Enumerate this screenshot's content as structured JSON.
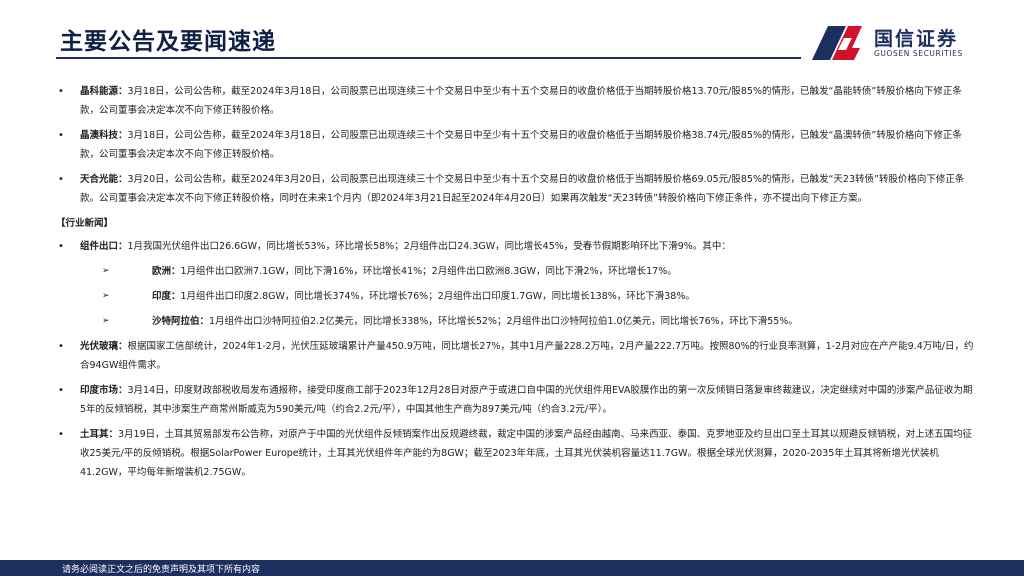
{
  "header": {
    "title": "主要公告及要闻速递",
    "logo_cn": "国信证券",
    "logo_en": "GUOSEN SECURITIES",
    "logo_icon": "guosen-logo-icon",
    "accent_red": "#d0122b",
    "brand_navy": "#1d2f5f"
  },
  "announcements": [
    {
      "name": "晶科能源：",
      "text": "3月18日，公司公告称，截至2024年3月18日，公司股票已出现连续三十个交易日中至少有十五个交易日的收盘价格低于当期转股价格13.70元/股85%的情形，已触发“晶能转债”转股价格向下修正条款，公司董事会决定本次不向下修正转股价格。"
    },
    {
      "name": "晶澳科技：",
      "text": "3月18日，公司公告称，截至2024年3月18日，公司股票已出现连续三十个交易日中至少有十五个交易日的收盘价格低于当期转股价格38.74元/股85%的情形，已触发“晶澳转债”转股价格向下修正条款，公司董事会决定本次不向下修正转股价格。"
    },
    {
      "name": "天合光能：",
      "text": "3月20日，公司公告称，截至2024年3月20日，公司股票已出现连续三十个交易日中至少有十五个交易日的收盘价格低于当期转股价格69.05元/股85%的情形，已触发“天23转债”转股价格向下修正条款。公司董事会决定本次不向下修正转股价格，同时在未来1个月内（即2024年3月21日起至2024年4月20日）如果再次触发“天23转债”转股价格向下修正条件，亦不提出向下修正方案。"
    }
  ],
  "industry": {
    "heading": "【行业新闻】",
    "export": {
      "name": "组件出口：",
      "text": "1月我国光伏组件出口26.6GW，同比增长53%，环比增长58%；2月组件出口24.3GW，同比增长45%，受春节假期影响环比下滑9%。其中："
    },
    "regions": [
      {
        "name": "欧洲：",
        "text": "1月组件出口欧洲7.1GW，同比下滑16%，环比增长41%；2月组件出口欧洲8.3GW，同比下滑2%，环比增长17%。"
      },
      {
        "name": "印度：",
        "text": "1月组件出口印度2.8GW，同比增长374%，环比增长76%；2月组件出口印度1.7GW，同比增长138%，环比下滑38%。"
      },
      {
        "name": "沙特阿拉伯：",
        "text": "1月组件出口沙特阿拉伯2.2亿美元，同比增长338%，环比增长52%；2月组件出口沙特阿拉伯1.0亿美元，同比增长76%，环比下滑55%。"
      }
    ],
    "news": [
      {
        "name": "光伏玻璃：",
        "text": "根据国家工信部统计，2024年1-2月，光伏压延玻璃累计产量450.9万吨，同比增长27%，其中1月产量228.2万吨，2月产量222.7万吨。按照80%的行业良率测算，1-2月对应在产产能9.4万吨/日，约合94GW组件需求。"
      },
      {
        "name": "印度市场：",
        "text": "3月14日，印度财政部税收局发布通报称，接受印度商工部于2023年12月28日对原产于或进口自中国的光伏组件用EVA胶膜作出的第一次反倾销日落复审终裁建议，决定继续对中国的涉案产品征收为期5年的反倾销税，其中涉案生产商常州斯威克为590美元/吨（约合2.2元/平），中国其他生产商为897美元/吨（约合3.2元/平）。"
      },
      {
        "name": "土耳其：",
        "text": "3月19日，土耳其贸易部发布公告称，对原产于中国的光伏组件反倾销案作出反规避终裁，裁定中国的涉案产品经由越南、马来西亚、泰国、克罗地亚及约旦出口至土耳其以规避反倾销税，对上述五国均征收25美元/平的反倾销税。根据SolarPower Europe统计，土耳其光伏组件年产能约为8GW；截至2023年年底，土耳其光伏装机容量达11.7GW。根据全球光伏测算，2020-2035年土耳其将新增光伏装机41.2GW，平均每年新增装机2.75GW。"
      }
    ]
  },
  "footer": {
    "disclaimer": "请务必阅读正文之后的免责声明及其项下所有内容"
  }
}
